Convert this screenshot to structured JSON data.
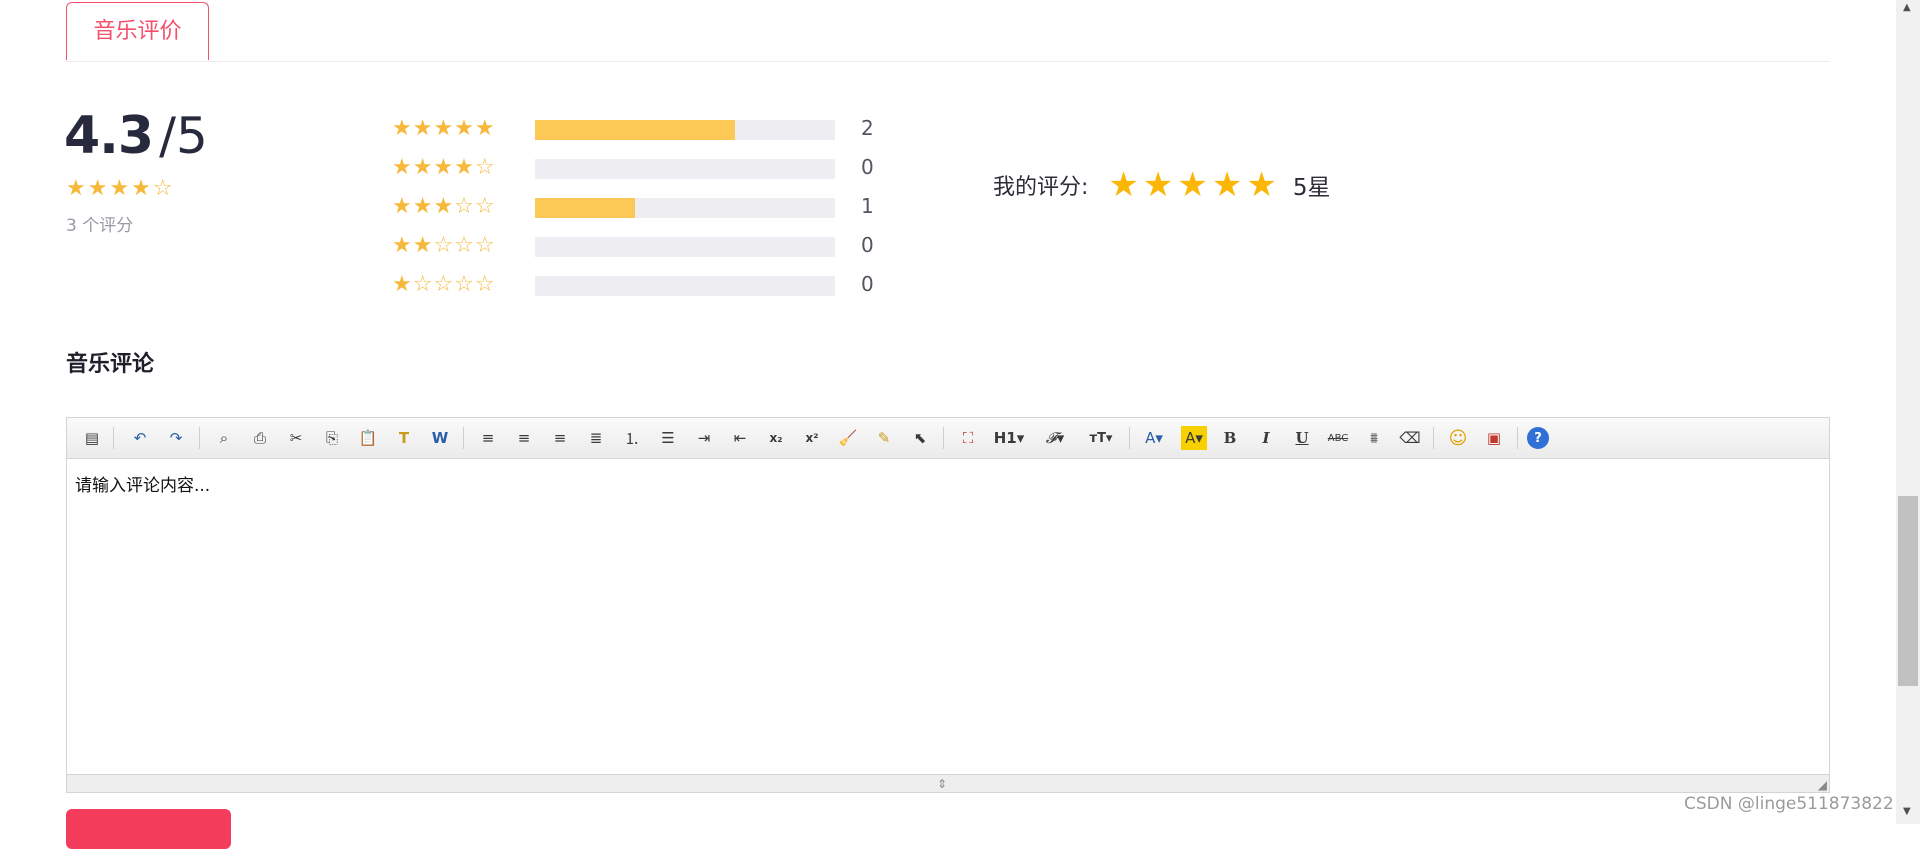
{
  "tab": {
    "label": "音乐评价"
  },
  "score": {
    "value": "4.3",
    "slash": "/",
    "max": "5",
    "stars": "★★★★☆",
    "count_text": "3 个评分",
    "star_color": "#f6b93b"
  },
  "distribution": {
    "rows": [
      {
        "stars": "★★★★★",
        "count": "2",
        "fraction": 0.667
      },
      {
        "stars": "★★★★☆",
        "count": "0",
        "fraction": 0
      },
      {
        "stars": "★★★☆☆",
        "count": "1",
        "fraction": 0.333
      },
      {
        "stars": "★★☆☆☆",
        "count": "0",
        "fraction": 0
      },
      {
        "stars": "★☆☆☆☆",
        "count": "0",
        "fraction": 0
      }
    ],
    "bar_color": "#fcc856",
    "track_color": "#ededf2"
  },
  "my_rating": {
    "label": "我的评分:",
    "stars": "★★★★★",
    "value_text": "5星",
    "star_color": "#fbb606"
  },
  "comment_section": {
    "title": "音乐评论"
  },
  "editor": {
    "placeholder": "请输入评论内容...",
    "toolbar": {
      "source": "▤",
      "undo": "↶",
      "redo": "↷",
      "preview": "⌕",
      "print": "⎙",
      "cut": "✂",
      "copy": "⎘",
      "paste": "📋",
      "paste_text": "T",
      "paste_word": "W",
      "align_left": "≡",
      "align_center": "≡",
      "align_right": "≡",
      "align_justify": "≣",
      "ordered_list": "⒈",
      "unordered_list": "☰",
      "indent": "⇥",
      "outdent": "⇤",
      "subscript": "x₂",
      "superscript": "x²",
      "clear_format": "🧹",
      "quick_format": "✎",
      "select_all": "⬉",
      "fullscreen": "⛶",
      "heading": "H1▾",
      "font_family": "𝓕▾",
      "font_size": "тT▾",
      "font_color": "A▾",
      "highlight": "A▾",
      "bold": "B",
      "italic": "I",
      "underline": "U",
      "strikethrough": "ABC",
      "line_height": "⩩",
      "remove_format": "⌫",
      "emoticon": "☺",
      "image": "▣",
      "about": "?"
    }
  },
  "watermark": "CSDN @linge511873822",
  "colors": {
    "accent": "#f4506b",
    "submit": "#f43c5c"
  }
}
